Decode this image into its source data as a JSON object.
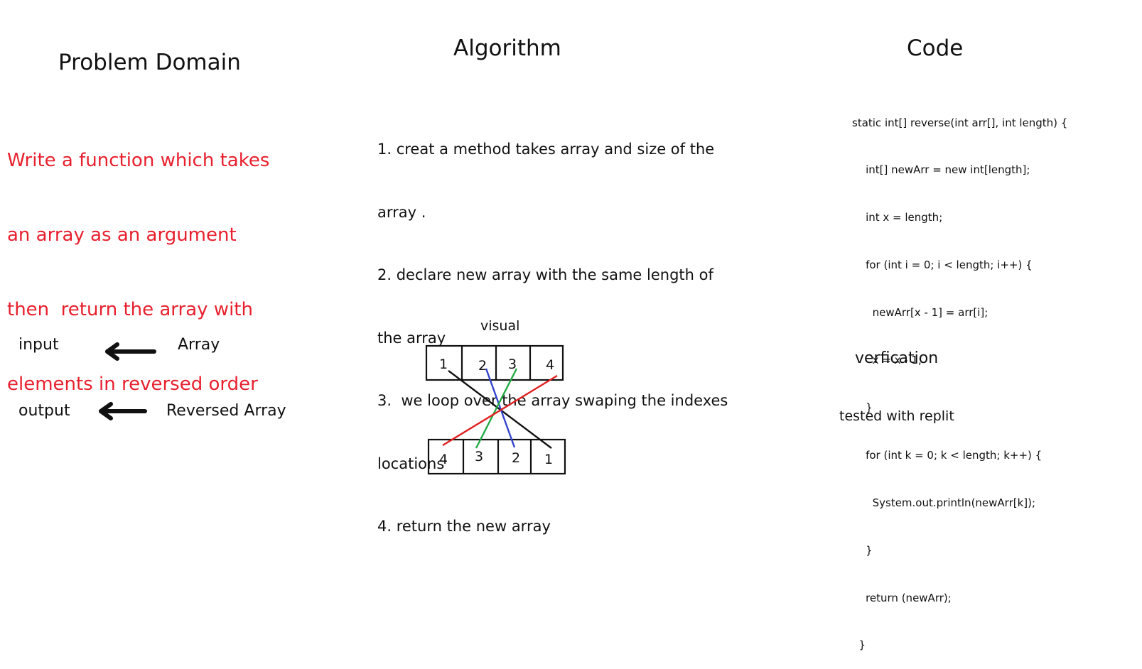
{
  "colors": {
    "problem_text": "#e8202e",
    "ink": "#111111",
    "line_red": "#e02020",
    "line_green": "#22aa44",
    "line_blue": "#3344cc",
    "line_black": "#111111"
  },
  "problem": {
    "title": "Problem Domain",
    "lines": [
      "Write a function which takes",
      "an array as an argument",
      "then  return the array with",
      "elements in reversed order"
    ]
  },
  "algorithm": {
    "title": "Algorithm",
    "lines": [
      "1. creat a method takes array and size of the",
      "array .",
      "2. declare new array with the same length of",
      "the array",
      "3.  we loop over the array swaping the indexes",
      "locations",
      "4. return the new array"
    ]
  },
  "code": {
    "title": "Code",
    "lines": [
      "static int[] reverse(int arr[], int length) {",
      "    int[] newArr = new int[length];",
      "    int x = length;",
      "    for (int i = 0; i < length; i++) {",
      "      newArr[x - 1] = arr[i];",
      "      x = x - 1;",
      "    }",
      "    for (int k = 0; k < length; k++) {",
      "      System.out.println(newArr[k]);",
      "    }",
      "    return (newArr);",
      "  }"
    ]
  },
  "io": {
    "input_label": "input",
    "input_value": "Array",
    "output_label": "output",
    "output_value": "Reversed Array",
    "arrow_icon": "left-arrow-icon"
  },
  "visual": {
    "label": "visual",
    "top_cells": [
      "1",
      "2",
      "3",
      "4"
    ],
    "bottom_cells": [
      "4",
      "3",
      "2",
      "1"
    ]
  },
  "verification": {
    "title": "verfication",
    "note": "tested with replit"
  }
}
